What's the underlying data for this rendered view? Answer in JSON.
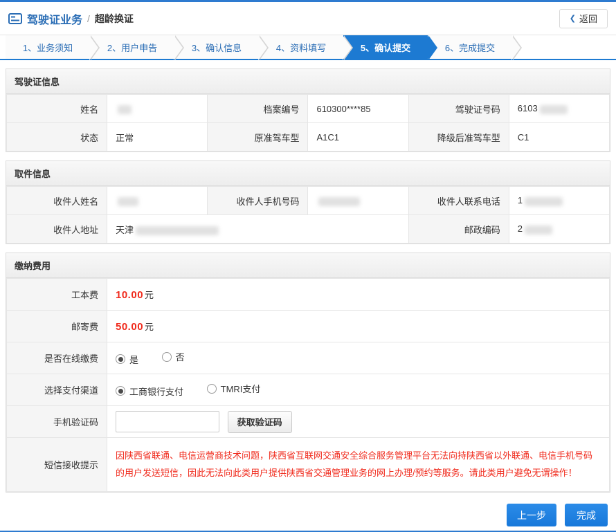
{
  "header": {
    "title_main": "驾驶证业务",
    "separator": "/",
    "title_sub": "超龄换证",
    "back_icon": "❮",
    "back_label": "返回"
  },
  "steps": [
    "1、业务须知",
    "2、用户申告",
    "3、确认信息",
    "4、资料填写",
    "5、确认提交",
    "6、完成提交"
  ],
  "license_section": {
    "title": "驾驶证信息",
    "name_label": "姓名",
    "file_no_label": "档案编号",
    "file_no_value": "610300****85",
    "license_no_label": "驾驶证号码",
    "license_no_prefix": "6103",
    "status_label": "状态",
    "status_value": "正常",
    "orig_class_label": "原准驾车型",
    "orig_class_value": "A1C1",
    "downgraded_class_label": "降级后准驾车型",
    "downgraded_class_value": "C1"
  },
  "pickup_section": {
    "title": "取件信息",
    "recipient_name_label": "收件人姓名",
    "recipient_phone_label": "收件人手机号码",
    "recipient_tel_label": "收件人联系电话",
    "recipient_tel_prefix": "1",
    "address_label": "收件人地址",
    "address_prefix": "天津",
    "postcode_label": "邮政编码",
    "postcode_prefix": "2"
  },
  "fees_section": {
    "title": "缴纳费用",
    "work_fee_label": "工本费",
    "work_fee_value": "10.00",
    "postage_label": "邮寄费",
    "postage_value": "50.00",
    "fee_unit": "元",
    "online_pay_label": "是否在线缴费",
    "online_pay_yes": "是",
    "online_pay_no": "否",
    "channel_label": "选择支付渠道",
    "channel_icbc": "工商银行支付",
    "channel_tmri": "TMRI支付",
    "captcha_label": "手机验证码",
    "captcha_button": "获取验证码",
    "sms_tip_label": "短信接收提示",
    "sms_tip_text": "因陕西省联通、电信运营商技术问题，陕西省互联网交通安全综合服务管理平台无法向持陕西省以外联通、电信手机号码的用户发送短信，因此无法向此类用户提供陕西省交通管理业务的网上办理/预约等服务。请此类用户避免无谓操作！"
  },
  "footer": {
    "prev_button": "上一步",
    "finish_button": "完成"
  },
  "colors": {
    "accent_blue": "#1d7ad2",
    "danger_red": "#f02b1d"
  }
}
